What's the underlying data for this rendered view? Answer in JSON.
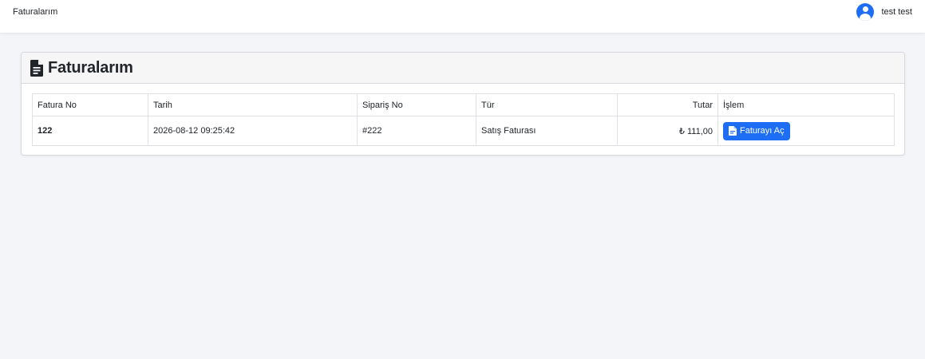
{
  "topbar": {
    "brand": "Faturalarım",
    "user_name": "test test",
    "accent_color": "#1d6ef5"
  },
  "page": {
    "title": "Faturalarım",
    "title_icon": "file-invoice-icon"
  },
  "table": {
    "headers": {
      "fatura_no": "Fatura No",
      "tarih": "Tarih",
      "siparis_no": "Sipariş No",
      "tur": "Tür",
      "tutar": "Tutar",
      "islem": "İşlem"
    },
    "rows": [
      {
        "fatura_no": "122",
        "tarih": "2026-08-12 09:25:42",
        "siparis_no": "#222",
        "tur": "Satış Faturası",
        "tutar": "₺ 111,00",
        "action_label": "Faturayı Aç",
        "action_icon": "file-pdf-icon"
      }
    ]
  }
}
